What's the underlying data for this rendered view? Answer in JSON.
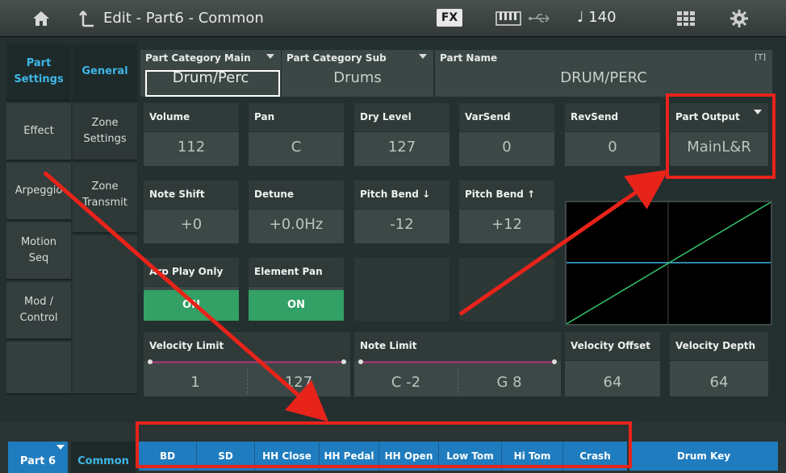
{
  "header": {
    "title": "Edit - Part6 - Common",
    "fx_label": "FX",
    "tempo": "♩ 140",
    "icons": [
      "home-icon",
      "back-icon",
      "keyboard-icon",
      "usb-icon",
      "grid-icon",
      "gear-icon"
    ]
  },
  "left_nav": {
    "items": [
      {
        "label": "Part\nSettings",
        "selected": true
      },
      {
        "label": "Effect",
        "selected": false
      },
      {
        "label": "Arpeggio",
        "selected": false
      },
      {
        "label": "Motion\nSeq",
        "selected": false
      },
      {
        "label": "Mod /\nControl",
        "selected": false
      }
    ]
  },
  "sub_nav": {
    "items": [
      {
        "label": "General",
        "selected": true
      },
      {
        "label": "Zone\nSettings",
        "selected": false
      },
      {
        "label": "Zone\nTransmit",
        "selected": false
      }
    ]
  },
  "category": {
    "main_label": "Part Category Main",
    "main_value": "Drum/Perc",
    "sub_label": "Part Category Sub",
    "sub_value": "Drums",
    "name_label": "Part Name",
    "name_value": "DRUM/PERC",
    "name_tag": "[T]"
  },
  "params_row1": [
    {
      "label": "Volume",
      "value": "112"
    },
    {
      "label": "Pan",
      "value": "C"
    },
    {
      "label": "Dry Level",
      "value": "127"
    },
    {
      "label": "VarSend",
      "value": "0"
    },
    {
      "label": "RevSend",
      "value": "0"
    },
    {
      "label": "Part Output",
      "value": "MainL&R"
    }
  ],
  "params_row2": [
    {
      "label": "Note Shift",
      "value": "+0"
    },
    {
      "label": "Detune",
      "value": "+0.0Hz"
    },
    {
      "label": "Pitch Bend ↓",
      "value": "-12"
    },
    {
      "label": "Pitch Bend ↑",
      "value": "+12"
    }
  ],
  "toggles": [
    {
      "label": "Arp Play Only",
      "value": "ON"
    },
    {
      "label": "Element Pan",
      "value": "ON"
    }
  ],
  "velocity_limit": {
    "label": "Velocity Limit",
    "low": "1",
    "high": "127"
  },
  "note_limit": {
    "label": "Note Limit",
    "low": "C -2",
    "high": "G 8"
  },
  "velocity_offset": {
    "label": "Velocity Offset",
    "value": "64"
  },
  "velocity_depth": {
    "label": "Velocity Depth",
    "value": "64"
  },
  "bottom": {
    "part": "Part 6",
    "common": "Common",
    "elements": [
      "BD",
      "SD",
      "HH Close",
      "HH Pedal",
      "HH Open",
      "Low Tom",
      "Hi Tom",
      "Crash"
    ],
    "drum_key": "Drum Key"
  },
  "colors": {
    "accent_blue": "#1f7cbf",
    "selected_text": "#3fb6e6",
    "toggle_on": "#33a065",
    "annotation_red": "#e8231a",
    "graph_line": "#33c46b",
    "graph_axis": "#3fb6e6"
  }
}
